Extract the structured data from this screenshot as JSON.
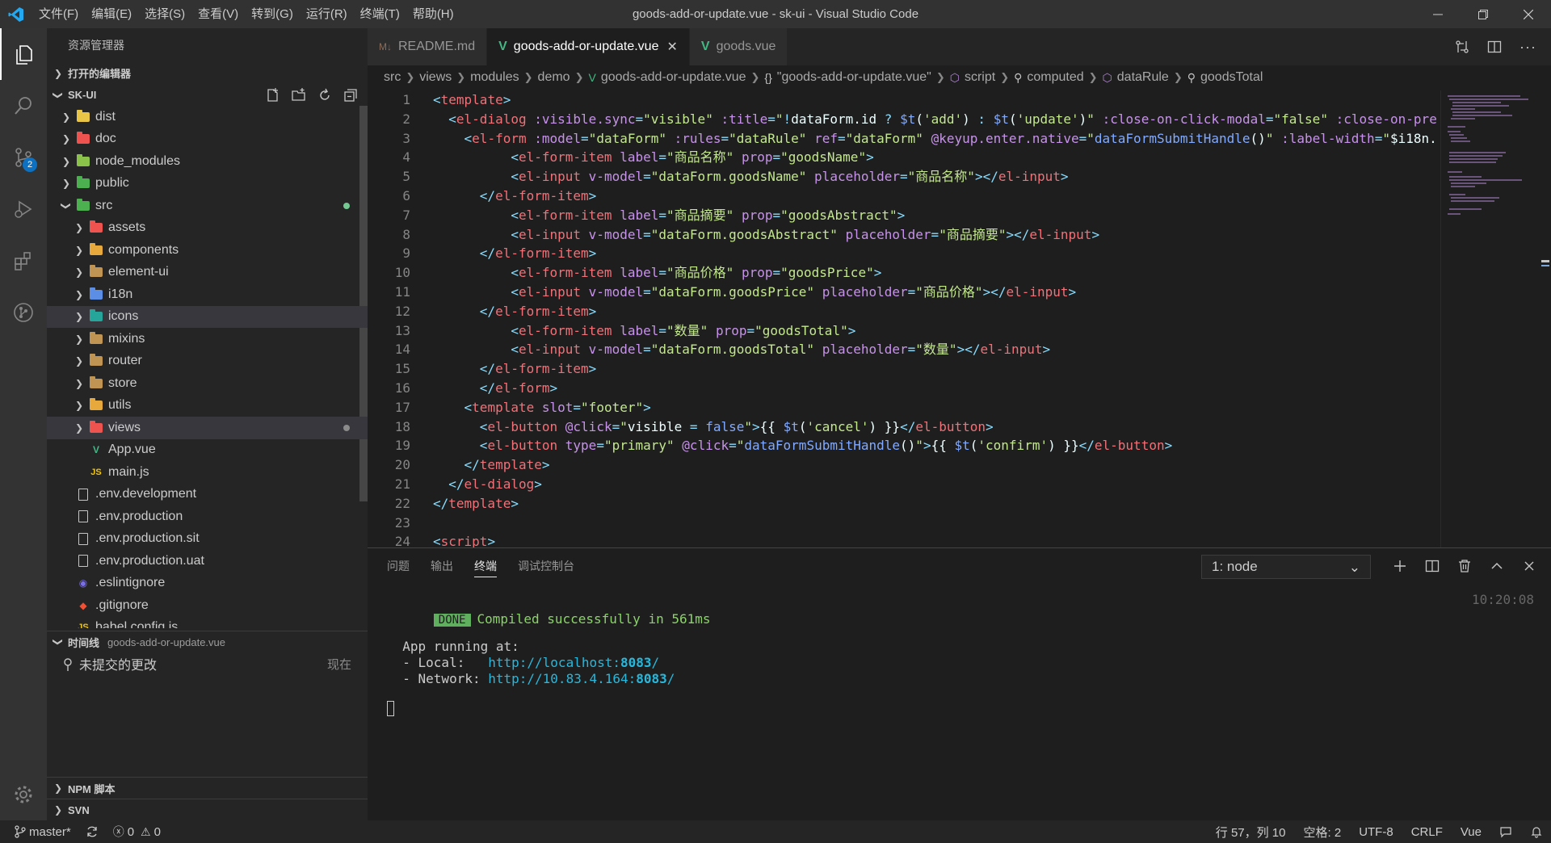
{
  "titlebar": {
    "menu": [
      "文件(F)",
      "编辑(E)",
      "选择(S)",
      "查看(V)",
      "转到(G)",
      "运行(R)",
      "终端(T)",
      "帮助(H)"
    ],
    "title": "goods-add-or-update.vue - sk-ui - Visual Studio Code"
  },
  "activitybar": {
    "scm_badge": "2"
  },
  "sidebar": {
    "title": "资源管理器",
    "open_editors": "打开的编辑器",
    "project": "SK-UI",
    "tree": [
      {
        "label": "dist",
        "indent": 1,
        "kind": "folder",
        "color": "#e8c547",
        "open": false
      },
      {
        "label": "doc",
        "indent": 1,
        "kind": "folder",
        "color": "#ef5350",
        "open": false
      },
      {
        "label": "node_modules",
        "indent": 1,
        "kind": "folder",
        "color": "#8bc34a",
        "open": false
      },
      {
        "label": "public",
        "indent": 1,
        "kind": "folder",
        "color": "#4caf50",
        "open": false
      },
      {
        "label": "src",
        "indent": 1,
        "kind": "folder",
        "color": "#4caf50",
        "open": true,
        "dot": "#73c991"
      },
      {
        "label": "assets",
        "indent": 2,
        "kind": "folder",
        "color": "#ef5350",
        "open": false
      },
      {
        "label": "components",
        "indent": 2,
        "kind": "folder",
        "color": "#e8a93c",
        "open": false
      },
      {
        "label": "element-ui",
        "indent": 2,
        "kind": "folder",
        "color": "#c09553",
        "open": false
      },
      {
        "label": "i18n",
        "indent": 2,
        "kind": "folder",
        "color": "#5c8ee6",
        "open": false
      },
      {
        "label": "icons",
        "indent": 2,
        "kind": "folder",
        "color": "#26a69a",
        "open": false,
        "selected": true
      },
      {
        "label": "mixins",
        "indent": 2,
        "kind": "folder",
        "color": "#c09553",
        "open": false
      },
      {
        "label": "router",
        "indent": 2,
        "kind": "folder",
        "color": "#c09553",
        "open": false
      },
      {
        "label": "store",
        "indent": 2,
        "kind": "folder",
        "color": "#c09553",
        "open": false
      },
      {
        "label": "utils",
        "indent": 2,
        "kind": "folder",
        "color": "#e8a93c",
        "open": false
      },
      {
        "label": "views",
        "indent": 2,
        "kind": "folder",
        "color": "#ef5350",
        "open": false,
        "selected": true,
        "dot": "#8b8b8b"
      },
      {
        "label": "App.vue",
        "indent": 2,
        "kind": "vue"
      },
      {
        "label": "main.js",
        "indent": 2,
        "kind": "js"
      },
      {
        "label": ".env.development",
        "indent": 1,
        "kind": "doc"
      },
      {
        "label": ".env.production",
        "indent": 1,
        "kind": "doc"
      },
      {
        "label": ".env.production.sit",
        "indent": 1,
        "kind": "doc"
      },
      {
        "label": ".env.production.uat",
        "indent": 1,
        "kind": "doc"
      },
      {
        "label": ".eslintignore",
        "indent": 1,
        "kind": "eslint"
      },
      {
        "label": ".gitignore",
        "indent": 1,
        "kind": "git"
      },
      {
        "label": "babel.config.js",
        "indent": 1,
        "kind": "js"
      }
    ],
    "timeline": {
      "header": "时间线",
      "file": "goods-add-or-update.vue",
      "item_label": "未提交的更改",
      "item_when": "现在"
    },
    "npm": "NPM 脚本",
    "svn": "SVN"
  },
  "tabs": [
    {
      "label": "README.md",
      "icon": "M↓",
      "active": false
    },
    {
      "label": "goods-add-or-update.vue",
      "icon": "V",
      "active": true
    },
    {
      "label": "goods.vue",
      "icon": "V",
      "active": false
    }
  ],
  "breadcrumb": [
    "src",
    "views",
    "modules",
    "demo",
    "goods-add-or-update.vue",
    "\"goods-add-or-update.vue\"",
    "script",
    "computed",
    "dataRule",
    "goodsTotal"
  ],
  "code": [
    {
      "n": "1",
      "i": 0,
      "t": [
        [
          "br",
          "<"
        ],
        [
          "tag",
          "template"
        ],
        [
          "br",
          ">"
        ]
      ]
    },
    {
      "n": "2",
      "i": 1,
      "t": [
        [
          "br",
          "<"
        ],
        [
          "tag",
          "el-dialog"
        ],
        [
          "txt",
          " "
        ],
        [
          "attr",
          ":visible.sync"
        ],
        [
          "br",
          "="
        ],
        [
          "str",
          "\"visible\""
        ],
        [
          "txt",
          " "
        ],
        [
          "attr",
          ":title"
        ],
        [
          "br",
          "="
        ],
        [
          "str",
          "\""
        ],
        [
          "br",
          "!"
        ],
        [
          "txt",
          "dataForm.id "
        ],
        [
          "br",
          "?"
        ],
        [
          "txt",
          " "
        ],
        [
          "fn",
          "$t"
        ],
        [
          "txt",
          "("
        ],
        [
          "str",
          "'add'"
        ],
        [
          "txt",
          ") "
        ],
        [
          "br",
          ":"
        ],
        [
          "txt",
          " "
        ],
        [
          "fn",
          "$t"
        ],
        [
          "txt",
          "("
        ],
        [
          "str",
          "'update'"
        ],
        [
          "txt",
          ")"
        ],
        [
          "str",
          "\""
        ],
        [
          "txt",
          " "
        ],
        [
          "attr",
          ":close-on-click-modal"
        ],
        [
          "br",
          "="
        ],
        [
          "str",
          "\"false\""
        ],
        [
          "txt",
          " "
        ],
        [
          "attr",
          ":close-on-pre"
        ]
      ]
    },
    {
      "n": "3",
      "i": 2,
      "t": [
        [
          "br",
          "<"
        ],
        [
          "tag",
          "el-form"
        ],
        [
          "txt",
          " "
        ],
        [
          "attr",
          ":model"
        ],
        [
          "br",
          "="
        ],
        [
          "str",
          "\"dataForm\""
        ],
        [
          "txt",
          " "
        ],
        [
          "attr",
          ":rules"
        ],
        [
          "br",
          "="
        ],
        [
          "str",
          "\"dataRule\""
        ],
        [
          "txt",
          " "
        ],
        [
          "attr",
          "ref"
        ],
        [
          "br",
          "="
        ],
        [
          "str",
          "\"dataForm\""
        ],
        [
          "txt",
          " "
        ],
        [
          "attr",
          "@keyup.enter.native"
        ],
        [
          "br",
          "="
        ],
        [
          "str",
          "\""
        ],
        [
          "fn",
          "dataFormSubmitHandle"
        ],
        [
          "txt",
          "()"
        ],
        [
          "str",
          "\""
        ],
        [
          "txt",
          " "
        ],
        [
          "attr",
          ":label-width"
        ],
        [
          "br",
          "="
        ],
        [
          "str",
          "\""
        ],
        [
          "txt",
          "$i18n."
        ]
      ]
    },
    {
      "n": "4",
      "i": 5,
      "t": [
        [
          "br",
          "<"
        ],
        [
          "tag",
          "el-form-item"
        ],
        [
          "txt",
          " "
        ],
        [
          "attr",
          "label"
        ],
        [
          "br",
          "="
        ],
        [
          "str",
          "\"商品名称\""
        ],
        [
          "txt",
          " "
        ],
        [
          "attr",
          "prop"
        ],
        [
          "br",
          "="
        ],
        [
          "str",
          "\"goodsName\""
        ],
        [
          "br",
          ">"
        ]
      ]
    },
    {
      "n": "5",
      "i": 5,
      "t": [
        [
          "br",
          "<"
        ],
        [
          "tag",
          "el-input"
        ],
        [
          "txt",
          " "
        ],
        [
          "attr",
          "v-model"
        ],
        [
          "br",
          "="
        ],
        [
          "str",
          "\"dataForm.goodsName\""
        ],
        [
          "txt",
          " "
        ],
        [
          "attr",
          "placeholder"
        ],
        [
          "br",
          "="
        ],
        [
          "str",
          "\"商品名称\""
        ],
        [
          "br",
          "></"
        ],
        [
          "tag",
          "el-input"
        ],
        [
          "br",
          ">"
        ]
      ]
    },
    {
      "n": "6",
      "i": 3,
      "t": [
        [
          "br",
          "</"
        ],
        [
          "tag",
          "el-form-item"
        ],
        [
          "br",
          ">"
        ]
      ]
    },
    {
      "n": "7",
      "i": 5,
      "t": [
        [
          "br",
          "<"
        ],
        [
          "tag",
          "el-form-item"
        ],
        [
          "txt",
          " "
        ],
        [
          "attr",
          "label"
        ],
        [
          "br",
          "="
        ],
        [
          "str",
          "\"商品摘要\""
        ],
        [
          "txt",
          " "
        ],
        [
          "attr",
          "prop"
        ],
        [
          "br",
          "="
        ],
        [
          "str",
          "\"goodsAbstract\""
        ],
        [
          "br",
          ">"
        ]
      ]
    },
    {
      "n": "8",
      "i": 5,
      "t": [
        [
          "br",
          "<"
        ],
        [
          "tag",
          "el-input"
        ],
        [
          "txt",
          " "
        ],
        [
          "attr",
          "v-model"
        ],
        [
          "br",
          "="
        ],
        [
          "str",
          "\"dataForm.goodsAbstract\""
        ],
        [
          "txt",
          " "
        ],
        [
          "attr",
          "placeholder"
        ],
        [
          "br",
          "="
        ],
        [
          "str",
          "\"商品摘要\""
        ],
        [
          "br",
          "></"
        ],
        [
          "tag",
          "el-input"
        ],
        [
          "br",
          ">"
        ]
      ]
    },
    {
      "n": "9",
      "i": 3,
      "t": [
        [
          "br",
          "</"
        ],
        [
          "tag",
          "el-form-item"
        ],
        [
          "br",
          ">"
        ]
      ]
    },
    {
      "n": "10",
      "i": 5,
      "t": [
        [
          "br",
          "<"
        ],
        [
          "tag",
          "el-form-item"
        ],
        [
          "txt",
          " "
        ],
        [
          "attr",
          "label"
        ],
        [
          "br",
          "="
        ],
        [
          "str",
          "\"商品价格\""
        ],
        [
          "txt",
          " "
        ],
        [
          "attr",
          "prop"
        ],
        [
          "br",
          "="
        ],
        [
          "str",
          "\"goodsPrice\""
        ],
        [
          "br",
          ">"
        ]
      ]
    },
    {
      "n": "11",
      "i": 5,
      "t": [
        [
          "br",
          "<"
        ],
        [
          "tag",
          "el-input"
        ],
        [
          "txt",
          " "
        ],
        [
          "attr",
          "v-model"
        ],
        [
          "br",
          "="
        ],
        [
          "str",
          "\"dataForm.goodsPrice\""
        ],
        [
          "txt",
          " "
        ],
        [
          "attr",
          "placeholder"
        ],
        [
          "br",
          "="
        ],
        [
          "str",
          "\"商品价格\""
        ],
        [
          "br",
          "></"
        ],
        [
          "tag",
          "el-input"
        ],
        [
          "br",
          ">"
        ]
      ]
    },
    {
      "n": "12",
      "i": 3,
      "t": [
        [
          "br",
          "</"
        ],
        [
          "tag",
          "el-form-item"
        ],
        [
          "br",
          ">"
        ]
      ]
    },
    {
      "n": "13",
      "i": 5,
      "t": [
        [
          "br",
          "<"
        ],
        [
          "tag",
          "el-form-item"
        ],
        [
          "txt",
          " "
        ],
        [
          "attr",
          "label"
        ],
        [
          "br",
          "="
        ],
        [
          "str",
          "\"数量\""
        ],
        [
          "txt",
          " "
        ],
        [
          "attr",
          "prop"
        ],
        [
          "br",
          "="
        ],
        [
          "str",
          "\"goodsTotal\""
        ],
        [
          "br",
          ">"
        ]
      ]
    },
    {
      "n": "14",
      "i": 5,
      "t": [
        [
          "br",
          "<"
        ],
        [
          "tag",
          "el-input"
        ],
        [
          "txt",
          " "
        ],
        [
          "attr",
          "v-model"
        ],
        [
          "br",
          "="
        ],
        [
          "str",
          "\"dataForm.goodsTotal\""
        ],
        [
          "txt",
          " "
        ],
        [
          "attr",
          "placeholder"
        ],
        [
          "br",
          "="
        ],
        [
          "str",
          "\"数量\""
        ],
        [
          "br",
          "></"
        ],
        [
          "tag",
          "el-input"
        ],
        [
          "br",
          ">"
        ]
      ]
    },
    {
      "n": "15",
      "i": 3,
      "t": [
        [
          "br",
          "</"
        ],
        [
          "tag",
          "el-form-item"
        ],
        [
          "br",
          ">"
        ]
      ]
    },
    {
      "n": "16",
      "i": 3,
      "t": [
        [
          "br",
          "</"
        ],
        [
          "tag",
          "el-form"
        ],
        [
          "br",
          ">"
        ]
      ]
    },
    {
      "n": "17",
      "i": 2,
      "t": [
        [
          "br",
          "<"
        ],
        [
          "tag",
          "template"
        ],
        [
          "txt",
          " "
        ],
        [
          "attr",
          "slot"
        ],
        [
          "br",
          "="
        ],
        [
          "str",
          "\"footer\""
        ],
        [
          "br",
          ">"
        ]
      ]
    },
    {
      "n": "18",
      "i": 3,
      "t": [
        [
          "br",
          "<"
        ],
        [
          "tag",
          "el-button"
        ],
        [
          "txt",
          " "
        ],
        [
          "attr",
          "@click"
        ],
        [
          "br",
          "="
        ],
        [
          "str",
          "\""
        ],
        [
          "txt",
          "visible "
        ],
        [
          "br",
          "="
        ],
        [
          "txt",
          " "
        ],
        [
          "t-fn",
          "false"
        ],
        [
          "str",
          "\""
        ],
        [
          "br",
          ">"
        ],
        [
          "txt",
          "{{ "
        ],
        [
          "fn",
          "$t"
        ],
        [
          "txt",
          "("
        ],
        [
          "str",
          "'cancel'"
        ],
        [
          "txt",
          ") }}"
        ],
        [
          "br",
          "</"
        ],
        [
          "tag",
          "el-button"
        ],
        [
          "br",
          ">"
        ]
      ]
    },
    {
      "n": "19",
      "i": 3,
      "t": [
        [
          "br",
          "<"
        ],
        [
          "tag",
          "el-button"
        ],
        [
          "txt",
          " "
        ],
        [
          "attr",
          "type"
        ],
        [
          "br",
          "="
        ],
        [
          "str",
          "\"primary\""
        ],
        [
          "txt",
          " "
        ],
        [
          "attr",
          "@click"
        ],
        [
          "br",
          "="
        ],
        [
          "str",
          "\""
        ],
        [
          "fn",
          "dataFormSubmitHandle"
        ],
        [
          "txt",
          "()"
        ],
        [
          "str",
          "\""
        ],
        [
          "br",
          ">"
        ],
        [
          "txt",
          "{{ "
        ],
        [
          "fn",
          "$t"
        ],
        [
          "txt",
          "("
        ],
        [
          "str",
          "'confirm'"
        ],
        [
          "txt",
          ") }}"
        ],
        [
          "br",
          "</"
        ],
        [
          "tag",
          "el-button"
        ],
        [
          "br",
          ">"
        ]
      ]
    },
    {
      "n": "20",
      "i": 2,
      "t": [
        [
          "br",
          "</"
        ],
        [
          "tag",
          "template"
        ],
        [
          "br",
          ">"
        ]
      ]
    },
    {
      "n": "21",
      "i": 1,
      "t": [
        [
          "br",
          "</"
        ],
        [
          "tag",
          "el-dialog"
        ],
        [
          "br",
          ">"
        ]
      ]
    },
    {
      "n": "22",
      "i": 0,
      "t": [
        [
          "br",
          "</"
        ],
        [
          "tag",
          "template"
        ],
        [
          "br",
          ">"
        ]
      ]
    },
    {
      "n": "23",
      "i": 0,
      "t": []
    },
    {
      "n": "24",
      "i": 0,
      "t": [
        [
          "br",
          "<"
        ],
        [
          "tag",
          "script"
        ],
        [
          "br",
          ">"
        ]
      ]
    }
  ],
  "panel": {
    "tabs": [
      "问题",
      "输出",
      "终端",
      "调试控制台"
    ],
    "active_tab": "终端",
    "terminal_select": "1: node",
    "terminal": {
      "done": "DONE",
      "compiled": "Compiled successfully in 561ms",
      "time": "10:20:08",
      "running": "App running at:",
      "local_label": "- Local:   ",
      "local_url": "http://localhost:",
      "local_port": "8083",
      "network_label": "- Network: ",
      "network_url": "http://10.83.4.164:",
      "network_port": "8083",
      "slash": "/"
    }
  },
  "statusbar": {
    "branch": "master*",
    "errors": "0",
    "warnings": "0",
    "position": "行 57，列 10",
    "spaces": "空格: 2",
    "encoding": "UTF-8",
    "eol": "CRLF",
    "language": "Vue"
  }
}
